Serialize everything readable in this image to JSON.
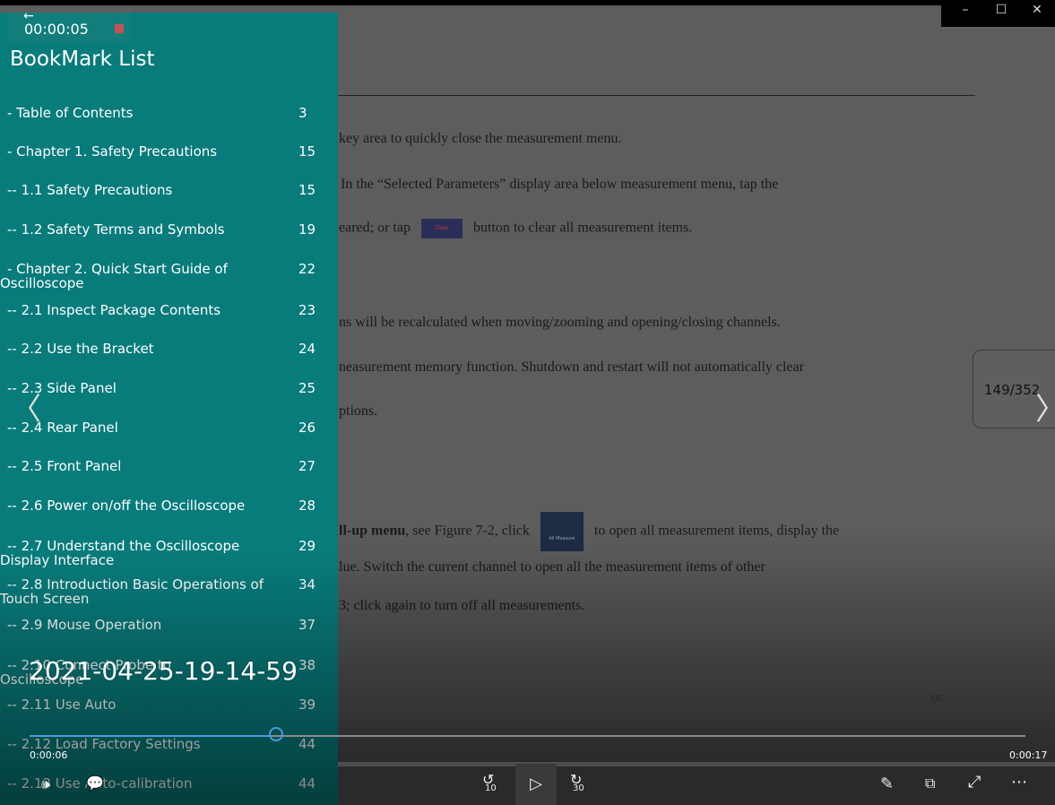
{
  "window": {
    "minimize": "–",
    "maximize": "☐",
    "close": "✕"
  },
  "recording": {
    "back": "←",
    "time": "00:00:05"
  },
  "sidebar": {
    "title": "BookMark List",
    "items": [
      {
        "label": "- Table of Contents",
        "page": "3"
      },
      {
        "label": "- Chapter 1. Safety Precautions",
        "page": "15"
      },
      {
        "label": "-- 1.1 Safety Precautions",
        "page": "15"
      },
      {
        "label": "-- 1.2 Safety Terms and Symbols",
        "page": "19"
      },
      {
        "label": "- Chapter 2. Quick Start Guide of",
        "label2": "Oscilloscope",
        "page": "22"
      },
      {
        "label": "-- 2.1 Inspect Package Contents",
        "page": "23"
      },
      {
        "label": "-- 2.2 Use the Bracket",
        "page": "24"
      },
      {
        "label": "-- 2.3 Side Panel",
        "page": "25"
      },
      {
        "label": "-- 2.4 Rear Panel",
        "page": "26"
      },
      {
        "label": "-- 2.5 Front Panel",
        "page": "27"
      },
      {
        "label": "-- 2.6 Power on/off the Oscilloscope",
        "page": "28"
      },
      {
        "label": "-- 2.7 Understand the Oscilloscope",
        "label2": "Display Interface",
        "page": "29"
      },
      {
        "label": "-- 2.8 Introduction Basic Operations of",
        "label2": "Touch Screen",
        "page": "34"
      },
      {
        "label": "-- 2.9 Mouse Operation",
        "page": "37"
      },
      {
        "label": "-- 2.10 Connect Probe to",
        "label2": "Oscilloscope",
        "page": "38"
      },
      {
        "label": "-- 2.11 Use Auto",
        "page": "39"
      },
      {
        "label": "-- 2.12 Load Factory Settings",
        "page": "44"
      },
      {
        "label": "-- 2.13 Use Auto-calibration",
        "page": "44"
      }
    ]
  },
  "document": {
    "line1": "key area to quickly close the measurement menu.",
    "line2": "In the “Selected Parameters” display area below measurement menu, tap the",
    "line3a": "eared; or tap",
    "clear_btn": "Clear",
    "line3b": "button to clear all measurement items.",
    "line4": "ns will be recalculated when moving/zooming and opening/closing channels.",
    "line5": "neasurement memory function. Shutdown and restart will not automatically clear",
    "line6": "ptions.",
    "line7_bold": "ll-up menu",
    "line7a": ", see Figure 7-2, click",
    "allmeasure_btn": "All Measure",
    "line7b": "to open all measurement items, display the",
    "line8": "lue. Switch the current channel to open all the measurement items of other",
    "line9": "3; click again to turn off all measurements.",
    "page_number": "135"
  },
  "page_indicator": "149/352",
  "overlay_timestamp": "2021-04-25-19-14-59",
  "player": {
    "current_time": "0:00:06",
    "total_time": "0:00:17",
    "progress": 0.24,
    "rewind_label": "10",
    "forward_label": "30",
    "play_icon": "▷",
    "volume_icon": "🕪",
    "captions_icon": "💬",
    "pen_icon": "✎",
    "miniview_icon": "⧉",
    "fullscreen_icon": "⤢",
    "more_icon": "⋯",
    "prev_icon": "〈",
    "next_icon": "〉"
  },
  "colors": {
    "sidebar": "#087b7b",
    "seek_accent": "#4a9be0",
    "stop_red": "#c65252"
  }
}
